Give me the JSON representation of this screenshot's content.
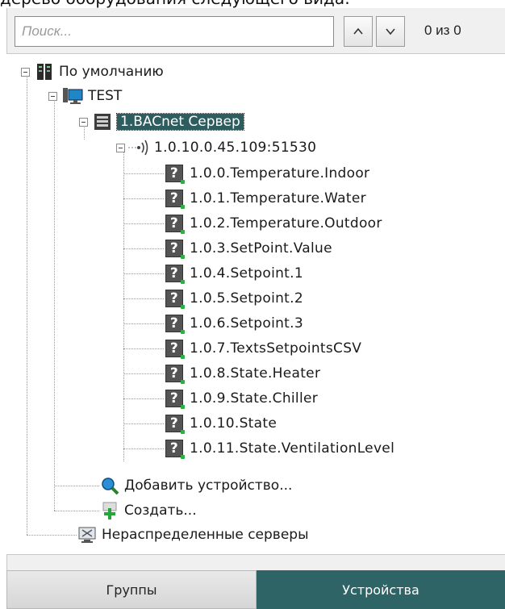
{
  "caption": "дерево оборудования следующего вида:",
  "search": {
    "placeholder": "Поиск...",
    "counter": "0 из 0"
  },
  "tree": {
    "root": "По умолчанию",
    "server": "TEST",
    "device": "1.BACnet Сервер",
    "address": "1.0.10.0.45.109:51530",
    "points": [
      "1.0.0.Temperature.Indoor",
      "1.0.1.Temperature.Water",
      "1.0.2.Temperature.Outdoor",
      "1.0.3.SetPoint.Value",
      "1.0.4.Setpoint.1",
      "1.0.5.Setpoint.2",
      "1.0.6.Setpoint.3",
      "1.0.7.TextsSetpointsCSV",
      "1.0.8.State.Heater",
      "1.0.9.State.Chiller",
      "1.0.10.State",
      "1.0.11.State.VentilationLevel"
    ],
    "point_icon_glyph": "?",
    "add_device": "Добавить устройство...",
    "create": "Создать...",
    "unassigned": "Нераспределенные серверы"
  },
  "tabs": {
    "groups": "Группы",
    "devices": "Устройства"
  },
  "colors": {
    "selected": "#2e5d60",
    "active_tab": "#2e6466"
  }
}
